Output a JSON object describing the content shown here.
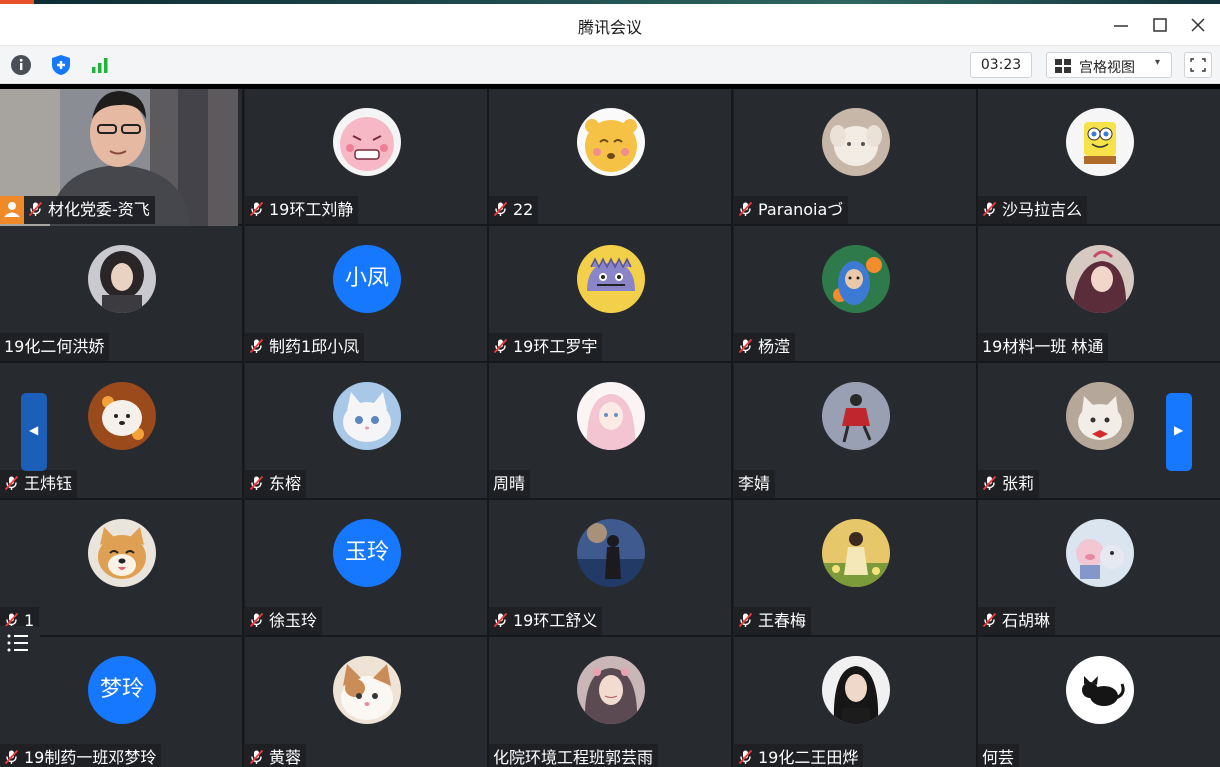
{
  "window": {
    "title": "腾讯会议"
  },
  "toolbar": {
    "timer": "03:23",
    "view_label": "宫格视图",
    "view_caret": "▾"
  },
  "participants": [
    {
      "name": "材化党委-资飞",
      "muted": true,
      "host": true,
      "video": true
    },
    {
      "name": "19环工刘静",
      "muted": true,
      "avatar": "pink-cartoon"
    },
    {
      "name": "22",
      "muted": true,
      "avatar": "yellow-bear"
    },
    {
      "name": "Paranoiaづ",
      "muted": true,
      "avatar": "white-puppy"
    },
    {
      "name": "沙马拉吉么",
      "muted": true,
      "avatar": "spongebob"
    },
    {
      "name": "19化二何洪娇",
      "muted": false,
      "avatar": "girl-photo"
    },
    {
      "name": "制药1邱小凤",
      "muted": true,
      "avatar_text": "小凤"
    },
    {
      "name": "19环工罗宇",
      "muted": true,
      "avatar": "purple-monster"
    },
    {
      "name": "杨滢",
      "muted": true,
      "avatar": "teletubby"
    },
    {
      "name": "19材料一班 林通",
      "muted": false,
      "avatar": "anime-girl"
    },
    {
      "name": "王炜钰",
      "muted": true,
      "avatar": "white-dog"
    },
    {
      "name": "东榕",
      "muted": true,
      "avatar": "white-kitten"
    },
    {
      "name": "周晴",
      "muted": false,
      "avatar": "anime-pink"
    },
    {
      "name": "李婧",
      "muted": false,
      "avatar": "red-figure"
    },
    {
      "name": "张莉",
      "muted": true,
      "avatar": "cat-bow"
    },
    {
      "name": "1",
      "muted": true,
      "avatar": "shiba"
    },
    {
      "name": "徐玉玲",
      "muted": true,
      "avatar_text": "玉玲"
    },
    {
      "name": "19环工舒义",
      "muted": true,
      "avatar": "girl-sea"
    },
    {
      "name": "王春梅",
      "muted": true,
      "avatar": "girl-flowers"
    },
    {
      "name": "石胡琳",
      "muted": true,
      "avatar": "pig-toys"
    },
    {
      "name": "19制药一班邓梦玲",
      "muted": true,
      "avatar_text": "梦玲"
    },
    {
      "name": "黄蓉",
      "muted": true,
      "avatar": "cat-face"
    },
    {
      "name": "化院环境工程班郭芸雨",
      "muted": false,
      "avatar": "painted-girl"
    },
    {
      "name": "19化二王田烨",
      "muted": true,
      "avatar": "girl-portrait"
    },
    {
      "name": "何芸",
      "muted": false,
      "avatar": "black-cat"
    }
  ],
  "colors": {
    "accent": "#1677ff",
    "host": "#f08a28",
    "tile_bg": "#272a2f"
  },
  "icons": [
    "info-icon",
    "security-shield-icon",
    "signal-icon",
    "grid-view-icon",
    "fullscreen-icon",
    "mic-muted-icon",
    "host-icon"
  ]
}
